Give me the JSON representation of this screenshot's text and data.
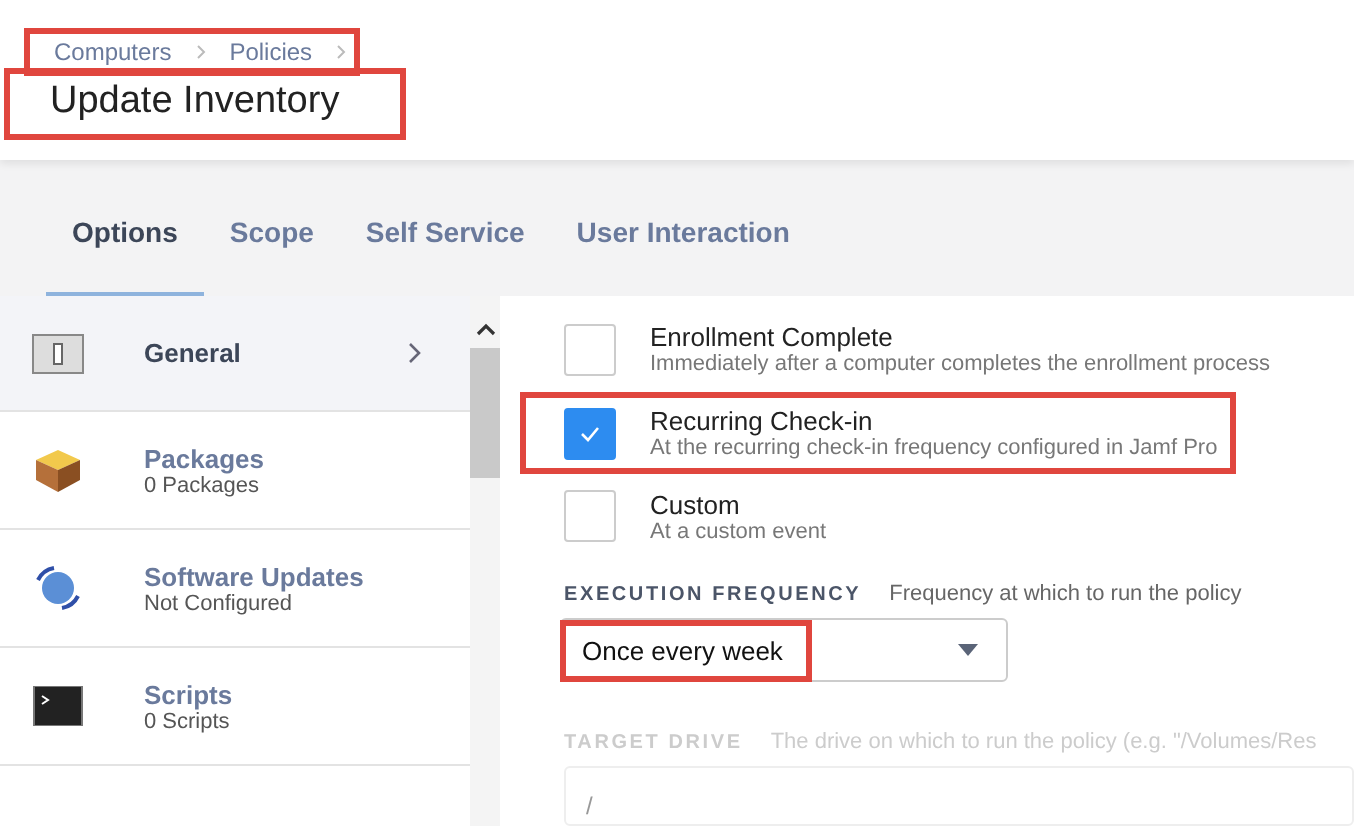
{
  "breadcrumb": {
    "items": [
      "Computers",
      "Policies"
    ],
    "highlighted": true
  },
  "title": {
    "text": "Update Inventory",
    "highlighted": true
  },
  "tabs": [
    {
      "label": "Options",
      "selected": true
    },
    {
      "label": "Scope",
      "selected": false
    },
    {
      "label": "Self Service",
      "selected": false
    },
    {
      "label": "User Interaction",
      "selected": false
    }
  ],
  "sidebar": {
    "items": [
      {
        "kind": "general",
        "label": "General",
        "selected": true
      },
      {
        "kind": "packages",
        "label": "Packages",
        "subtitle": "0 Packages",
        "selected": false
      },
      {
        "kind": "updates",
        "label": "Software Updates",
        "subtitle": "Not Configured",
        "selected": false
      },
      {
        "kind": "scripts",
        "label": "Scripts",
        "subtitle": "0 Scripts",
        "selected": false
      }
    ]
  },
  "triggers": [
    {
      "label": "Enrollment Complete",
      "description": "Immediately after a computer completes the enrollment process",
      "checked": false,
      "highlighted": false
    },
    {
      "label": "Recurring Check-in",
      "description": "At the recurring check-in frequency configured in Jamf Pro",
      "checked": true,
      "highlighted": true
    },
    {
      "label": "Custom",
      "description": "At a custom event",
      "checked": false,
      "highlighted": false
    }
  ],
  "execution_frequency": {
    "label": "EXECUTION FREQUENCY",
    "hint": "Frequency at which to run the policy",
    "value": "Once every week",
    "highlighted": true
  },
  "target_drive": {
    "label": "TARGET DRIVE",
    "hint": "The drive on which to run the policy (e.g. \"/Volumes/Res",
    "value": "/"
  }
}
